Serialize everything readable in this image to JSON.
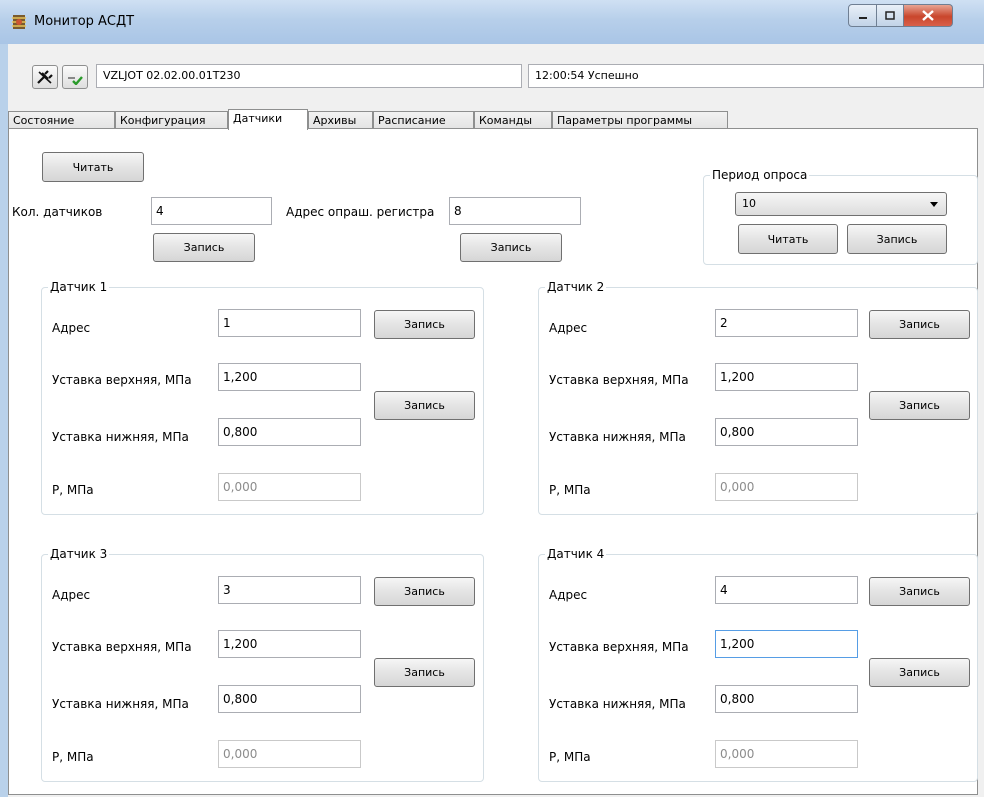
{
  "window": {
    "title": "Монитор АСДТ"
  },
  "toolbar": {
    "device_id": "VZLJOT 02.02.00.01T230",
    "status": "12:00:54 Успешно",
    "disconnect_icon": "disconnect-plug-icon",
    "connect_icon": "connect-check-icon"
  },
  "tabs": [
    "Состояние",
    "Конфигурация",
    "Датчики",
    "Архивы",
    "Расписание",
    "Команды",
    "Параметры программы"
  ],
  "active_tab": "Датчики",
  "top": {
    "read_label": "Читать",
    "sensor_count_label": "Кол. датчиков",
    "sensor_count": "4",
    "register_label": "Адрес опраш. регистра",
    "register_value": "8",
    "write_label": "Запись"
  },
  "period": {
    "title": "Период опроса",
    "selected": "10",
    "read_label": "Читать",
    "write_label": "Запись"
  },
  "sensor_labels": {
    "address": "Адрес",
    "upper": "Уставка верхняя, МПа",
    "lower": "Уставка нижняя, МПа",
    "pressure": "P, МПа",
    "write": "Запись"
  },
  "sensors": [
    {
      "title": "Датчик 1",
      "address": "1",
      "upper": "1,200",
      "lower": "0,800",
      "pressure": "0,000"
    },
    {
      "title": "Датчик 2",
      "address": "2",
      "upper": "1,200",
      "lower": "0,800",
      "pressure": "0,000"
    },
    {
      "title": "Датчик 3",
      "address": "3",
      "upper": "1,200",
      "lower": "0,800",
      "pressure": "0,000"
    },
    {
      "title": "Датчик 4",
      "address": "4",
      "upper": "1,200",
      "lower": "0,800",
      "pressure": "0,000"
    }
  ]
}
